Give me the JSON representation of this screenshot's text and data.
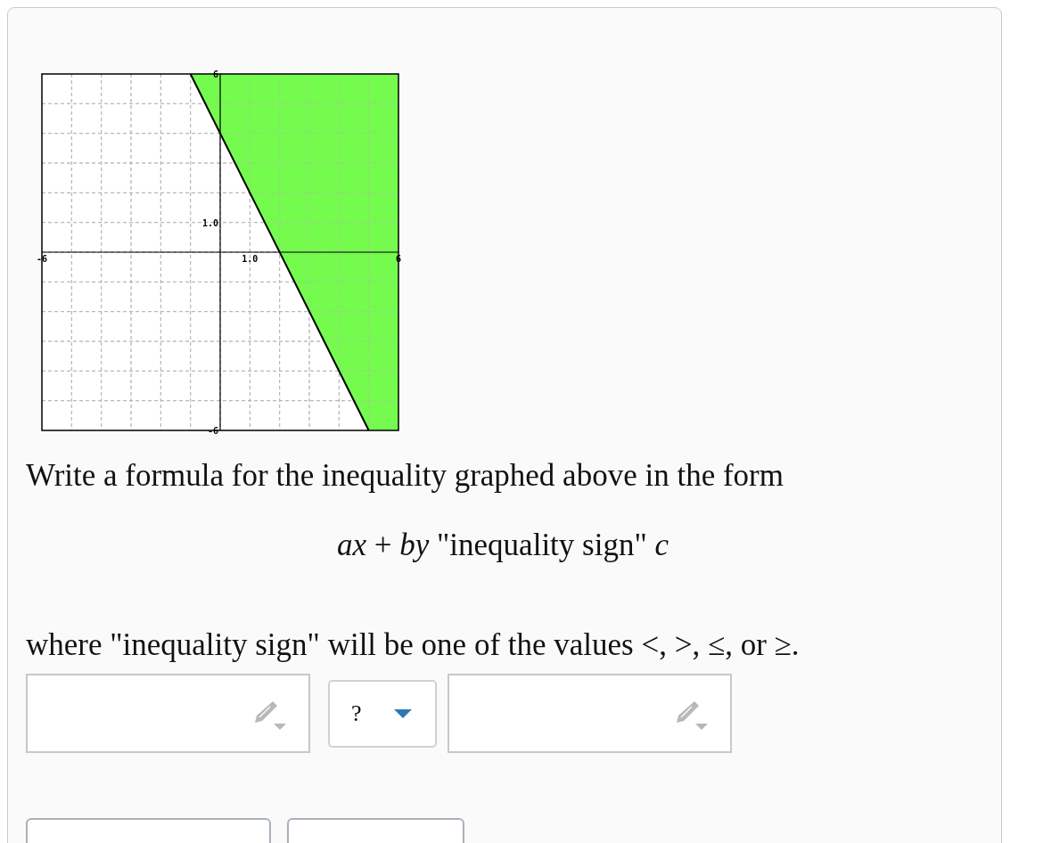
{
  "graph": {
    "chart_data": {
      "type": "line",
      "xlim": [
        -6,
        6
      ],
      "ylim": [
        -6,
        6
      ],
      "grid": true,
      "xticks": [
        {
          "value": -6,
          "label": "-6"
        },
        {
          "value": 1,
          "label": "1.0"
        },
        {
          "value": 6,
          "label": "6"
        }
      ],
      "yticks": [
        {
          "value": 6,
          "label": "6"
        },
        {
          "value": 1,
          "label": "1.0"
        },
        {
          "value": -6,
          "label": "-6"
        }
      ],
      "x": [
        -1,
        5
      ],
      "series": [
        {
          "color": "#000000",
          "values": [
            6,
            -6
          ]
        }
      ]
    }
  },
  "question": {
    "prompt": "Write a formula for the inequality graphed above in the form",
    "formula": "*ax* + *by* \"inequality sign\" *c*",
    "note": "where \"inequality sign\" will be one of the values <, >, ≤, or ≥."
  },
  "answer": {
    "left_field": {
      "kind": "math"
    },
    "sign_dropdown": {
      "value": "?"
    },
    "right_field": {
      "kind": "math"
    }
  }
}
